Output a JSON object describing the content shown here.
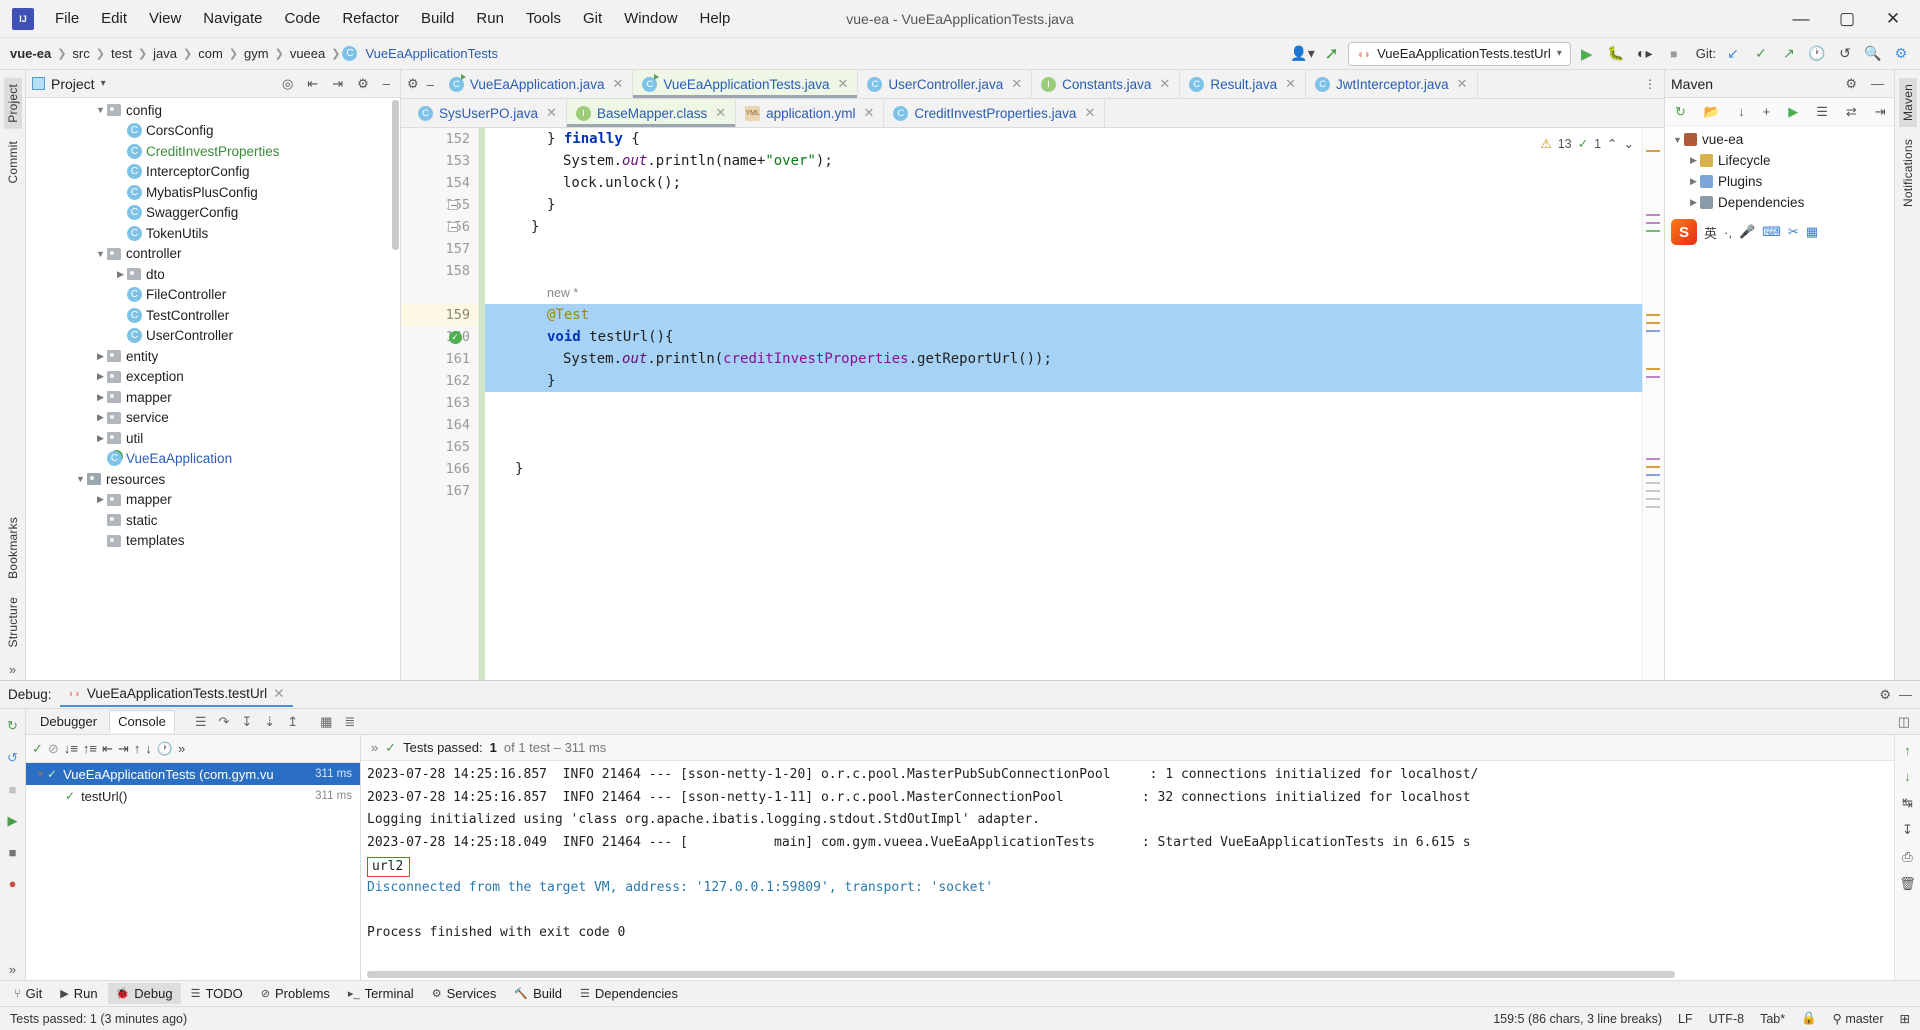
{
  "titlebar": {
    "logo": "intellij-logo",
    "window_title": "vue-ea - VueEaApplicationTests.java",
    "menu": [
      "File",
      "Edit",
      "View",
      "Navigate",
      "Code",
      "Refactor",
      "Build",
      "Run",
      "Tools",
      "Git",
      "Window",
      "Help"
    ],
    "minimize": "—",
    "maximize": "▢",
    "close": "✕"
  },
  "navbar": {
    "breadcrumbs": [
      "vue-ea",
      "src",
      "test",
      "java",
      "com",
      "gym",
      "vueea",
      "VueEaApplicationTests"
    ],
    "separator": "❯",
    "run_config": "VueEaApplicationTests.testUrl",
    "run_config_caret": "▾",
    "profile_icon": "user-profile-icon",
    "build_icon": "hammer-icon",
    "run_icon": "▶",
    "debug_icon": "debug-bug-icon",
    "coverage_icon": "coverage-icon",
    "stop_icon": "■",
    "git_label": "Git:",
    "git_update_icon": "↙",
    "git_commit_icon": "✓",
    "git_push_icon": "↗",
    "history_icon": "🕐",
    "undo_icon": "↺",
    "search_icon": "🔍",
    "settings_icon": "⚙"
  },
  "leftstrip": {
    "tabs": [
      "Project",
      "Commit"
    ],
    "bottom_icons": [
      "structure-icon",
      "bookmarks-icon"
    ]
  },
  "rightstrip": {
    "tabs": [
      "Maven",
      "Notifications"
    ]
  },
  "project": {
    "title": "Project",
    "caret": "▾",
    "toolbar_icons": [
      "locate-icon",
      "expand-all-icon",
      "collapse-all-icon",
      "settings-icon",
      "hide-icon"
    ],
    "tree": [
      {
        "indent": 3,
        "arrow": "v",
        "icon": "folder",
        "label": "config",
        "color": ""
      },
      {
        "indent": 4,
        "arrow": "",
        "icon": "class",
        "label": "CorsConfig",
        "color": ""
      },
      {
        "indent": 4,
        "arrow": "",
        "icon": "class",
        "label": "CreditInvestProperties",
        "color": "green"
      },
      {
        "indent": 4,
        "arrow": "",
        "icon": "class",
        "label": "InterceptorConfig",
        "color": ""
      },
      {
        "indent": 4,
        "arrow": "",
        "icon": "class",
        "label": "MybatisPlusConfig",
        "color": ""
      },
      {
        "indent": 4,
        "arrow": "",
        "icon": "class",
        "label": "SwaggerConfig",
        "color": ""
      },
      {
        "indent": 4,
        "arrow": "",
        "icon": "class",
        "label": "TokenUtils",
        "color": ""
      },
      {
        "indent": 3,
        "arrow": "v",
        "icon": "folder",
        "label": "controller",
        "color": ""
      },
      {
        "indent": 4,
        "arrow": ">",
        "icon": "folder",
        "label": "dto",
        "color": ""
      },
      {
        "indent": 4,
        "arrow": "",
        "icon": "class",
        "label": "FileController",
        "color": ""
      },
      {
        "indent": 4,
        "arrow": "",
        "icon": "class",
        "label": "TestController",
        "color": ""
      },
      {
        "indent": 4,
        "arrow": "",
        "icon": "class",
        "label": "UserController",
        "color": ""
      },
      {
        "indent": 3,
        "arrow": ">",
        "icon": "folder",
        "label": "entity",
        "color": ""
      },
      {
        "indent": 3,
        "arrow": ">",
        "icon": "folder",
        "label": "exception",
        "color": ""
      },
      {
        "indent": 3,
        "arrow": ">",
        "icon": "folder",
        "label": "mapper",
        "color": ""
      },
      {
        "indent": 3,
        "arrow": ">",
        "icon": "folder",
        "label": "service",
        "color": ""
      },
      {
        "indent": 3,
        "arrow": ">",
        "icon": "folder",
        "label": "util",
        "color": ""
      },
      {
        "indent": 3,
        "arrow": "",
        "icon": "classrun",
        "label": "VueEaApplication",
        "color": "blue"
      },
      {
        "indent": 2,
        "arrow": "v",
        "icon": "folderres",
        "label": "resources",
        "color": ""
      },
      {
        "indent": 3,
        "arrow": ">",
        "icon": "folder",
        "label": "mapper",
        "color": ""
      },
      {
        "indent": 3,
        "arrow": "",
        "icon": "folder",
        "label": "static",
        "color": ""
      },
      {
        "indent": 3,
        "arrow": "",
        "icon": "folder",
        "label": "templates",
        "color": ""
      }
    ]
  },
  "editor": {
    "gutter_icons": [
      "settings-icon",
      "minimize-icon"
    ],
    "tabs_row1": [
      {
        "label": "VueEaApplication.java",
        "icon": "class-run",
        "active": false
      },
      {
        "label": "VueEaApplicationTests.java",
        "icon": "class-run",
        "active": true
      },
      {
        "label": "UserController.java",
        "icon": "class",
        "active": false
      },
      {
        "label": "Constants.java",
        "icon": "interface",
        "active": false
      },
      {
        "label": "Result.java",
        "icon": "class",
        "active": false
      },
      {
        "label": "JwtInterceptor.java",
        "icon": "class",
        "active": false
      }
    ],
    "tabs_row2": [
      {
        "label": "SysUserPO.java",
        "icon": "class",
        "active": false
      },
      {
        "label": "BaseMapper.class",
        "icon": "interface",
        "active": true
      },
      {
        "label": "application.yml",
        "icon": "yml",
        "active": false
      },
      {
        "label": "CreditInvestProperties.java",
        "icon": "class",
        "active": false
      }
    ],
    "tabs_overflow": "⋮",
    "inspection": {
      "warnings": "13",
      "checks": "1",
      "warn_icon": "⚠",
      "check_icon": "✓",
      "up": "⌃",
      "down": "⌄"
    },
    "lines": [
      {
        "n": "152",
        "text": "} finally {",
        "partial": true,
        "sel": false
      },
      {
        "n": "153",
        "text": "System.out.println(name+\"over\");",
        "sel": false
      },
      {
        "n": "154",
        "text": "lock.unlock();",
        "sel": false
      },
      {
        "n": "155",
        "text": "}",
        "sel": false
      },
      {
        "n": "156",
        "text": "}",
        "sel": false
      },
      {
        "n": "157",
        "text": "",
        "sel": false
      },
      {
        "n": "158",
        "text": "",
        "sel": false
      },
      {
        "n": "",
        "text": "new *",
        "hint": true,
        "sel": false
      },
      {
        "n": "159",
        "text": "@Test",
        "sel": true
      },
      {
        "n": "160",
        "text": "void testUrl(){",
        "sel": true
      },
      {
        "n": "161",
        "text": "System.out.println(creditInvestProperties.getReportUrl());",
        "sel": true
      },
      {
        "n": "162",
        "text": "}",
        "sel": true
      },
      {
        "n": "163",
        "text": "",
        "sel": false
      },
      {
        "n": "164",
        "text": "",
        "sel": false
      },
      {
        "n": "165",
        "text": "",
        "sel": false
      },
      {
        "n": "166",
        "text": "}",
        "sel": false
      },
      {
        "n": "167",
        "text": "",
        "sel": false
      }
    ]
  },
  "maven": {
    "title": "Maven",
    "toolbar_icons": [
      "refresh-icon",
      "add-maven-icon",
      "download-sources-icon",
      "add-icon",
      "run-icon",
      "execute-goal-icon",
      "toggle-icon",
      "collapse-icon"
    ],
    "settings_icon": "⚙",
    "hide_icon": "—",
    "tree": [
      {
        "indent": 0,
        "arrow": "v",
        "icon": "maven-project",
        "label": "vue-ea"
      },
      {
        "indent": 1,
        "arrow": ">",
        "icon": "lifecycle-folder",
        "label": "Lifecycle"
      },
      {
        "indent": 1,
        "arrow": ">",
        "icon": "plugins-folder",
        "label": "Plugins"
      },
      {
        "indent": 1,
        "arrow": ">",
        "icon": "dependencies-folder",
        "label": "Dependencies"
      }
    ],
    "ime": {
      "logo": "S",
      "lang": "英",
      "punct": "·,",
      "mic": "mic-icon",
      "keyboard": "keyboard-icon",
      "tool": "tool-icon",
      "grid": "grid-icon"
    }
  },
  "debug": {
    "label": "Debug:",
    "session_tab": "VueEaApplicationTests.testUrl",
    "session_close": "✕",
    "settings_icon": "⚙",
    "hide_icon": "—",
    "tabs": [
      "Debugger",
      "Console"
    ],
    "selected_tab": "Console",
    "tab_icons": [
      "layout-icon",
      "step-over-icon",
      "step-into-icon",
      "force-step-into-icon",
      "step-out-icon",
      "evaluate-icon",
      "frames-icon"
    ],
    "left_icons": [
      "rerun-icon",
      "rerun-failed-icon",
      "stop-icon",
      "resume-icon",
      "pause-icon"
    ],
    "test_toolbar_icons": [
      "show-passed-icon",
      "hide-ignored-icon",
      "sort-alpha-icon",
      "sort-duration-icon",
      "expand-icon",
      "collapse-icon",
      "prev-icon",
      "next-icon",
      "history-icon",
      "more-icon"
    ],
    "status_text_prefix": "Tests passed:",
    "status_count": "1",
    "status_suffix": "of 1 test – 311 ms",
    "status_check": "✓",
    "tests": [
      {
        "label": "VueEaApplicationTests (com.gym.vu",
        "time": "311 ms",
        "selected": true,
        "check": "✓"
      },
      {
        "label": "testUrl()",
        "time": "311 ms",
        "selected": false,
        "check": "✓"
      }
    ],
    "console_lines": [
      {
        "text": "2023-07-28 14:25:16.857  INFO 21464 --- [sson-netty-1-20] o.r.c.pool.MasterPubSubConnectionPool     : 1 connections initialized for localhost/",
        "style": "plain"
      },
      {
        "text": "2023-07-28 14:25:16.857  INFO 21464 --- [sson-netty-1-11] o.r.c.pool.MasterConnectionPool          : 32 connections initialized for localhost",
        "style": "plain"
      },
      {
        "text": "Logging initialized using 'class org.apache.ibatis.logging.stdout.StdOutImpl' adapter.",
        "style": "plain"
      },
      {
        "text": "2023-07-28 14:25:18.049  INFO 21464 --- [           main] com.gym.vueea.VueEaApplicationTests      : Started VueEaApplicationTests in 6.615 s",
        "style": "plain"
      },
      {
        "text": "url2",
        "style": "boxed"
      },
      {
        "text": "Disconnected from the target VM, address: '127.0.0.1:59809', transport: 'socket'",
        "style": "info"
      },
      {
        "text": "",
        "style": "plain"
      },
      {
        "text": "Process finished with exit code 0",
        "style": "plain"
      }
    ],
    "console_right_icons": [
      "scroll-up-icon",
      "scroll-down-icon",
      "soft-wrap-icon",
      "scroll-end-icon",
      "print-icon",
      "clear-icon"
    ]
  },
  "bottombar": {
    "items": [
      {
        "label": "Git",
        "icon": "git-icon",
        "selected": false
      },
      {
        "label": "Run",
        "icon": "run-icon",
        "selected": false
      },
      {
        "label": "Debug",
        "icon": "debug-icon",
        "selected": true
      },
      {
        "label": "TODO",
        "icon": "todo-icon",
        "selected": false
      },
      {
        "label": "Problems",
        "icon": "problems-icon",
        "selected": false
      },
      {
        "label": "Terminal",
        "icon": "terminal-icon",
        "selected": false
      },
      {
        "label": "Services",
        "icon": "services-icon",
        "selected": false
      },
      {
        "label": "Build",
        "icon": "build-icon",
        "selected": false
      },
      {
        "label": "Dependencies",
        "icon": "dependencies-icon",
        "selected": false
      }
    ]
  },
  "statusbar": {
    "left": "Tests passed: 1 (3 minutes ago)",
    "caret": "159:5 (86 chars, 3 line breaks)",
    "line_sep": "LF",
    "encoding": "UTF-8",
    "indent": "Tab*",
    "branch": "master",
    "branch_icon": "git-branch-icon",
    "lock_icon": "🔒",
    "memory": "⊞"
  }
}
